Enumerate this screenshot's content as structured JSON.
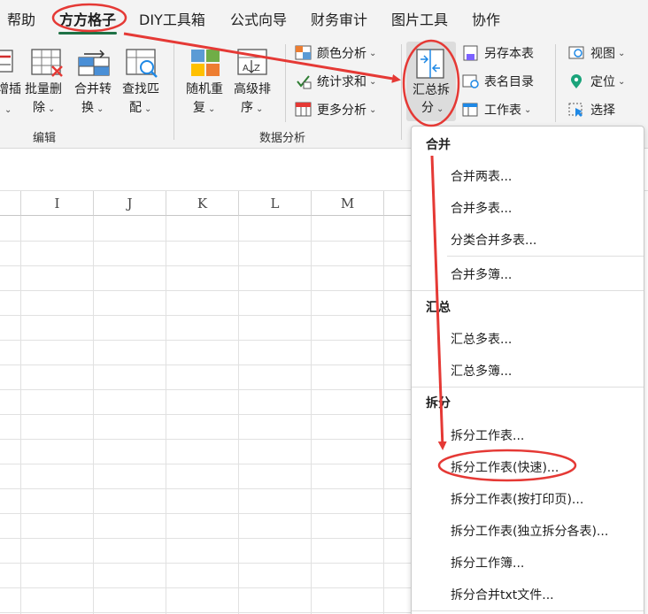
{
  "menubar": {
    "tabs": [
      {
        "label": "帮助",
        "active": false
      },
      {
        "label": "方方格子",
        "active": true
      },
      {
        "label": "DIY工具箱",
        "active": false
      },
      {
        "label": "公式向导",
        "active": false
      },
      {
        "label": "财务审计",
        "active": false
      },
      {
        "label": "图片工具",
        "active": false
      },
      {
        "label": "协作",
        "active": false
      }
    ]
  },
  "ribbon": {
    "edit_group": {
      "label": "编辑",
      "buttons": [
        {
          "line1": "增插",
          "line2": "",
          "icon": "insert-icon"
        },
        {
          "line1": "批量删",
          "line2": "除",
          "icon": "batch-delete-icon"
        },
        {
          "line1": "合并转",
          "line2": "换",
          "icon": "merge-convert-icon"
        },
        {
          "line1": "查找匹",
          "line2": "配",
          "icon": "lookup-match-icon"
        }
      ]
    },
    "analysis_group": {
      "label": "数据分析",
      "buttons": [
        {
          "line1": "随机重",
          "line2": "复",
          "icon": "random-repeat-icon"
        },
        {
          "line1": "高级排",
          "line2": "序",
          "icon": "advanced-sort-icon"
        }
      ],
      "small_buttons": [
        {
          "label": "颜色分析",
          "icon": "color-analysis-icon"
        },
        {
          "label": "统计求和",
          "icon": "stat-sum-icon"
        },
        {
          "label": "更多分析",
          "icon": "more-analysis-icon"
        }
      ]
    },
    "summary_button": {
      "line1": "汇总拆",
      "line2": "分",
      "icon": "summary-split-icon"
    },
    "sheet_small_buttons": [
      {
        "label": "另存本表",
        "icon": "save-sheet-icon"
      },
      {
        "label": "表名目录",
        "icon": "sheet-directory-icon"
      },
      {
        "label": "工作表",
        "icon": "worksheet-icon"
      }
    ],
    "view_small_buttons": [
      {
        "label": "视图",
        "icon": "view-icon"
      },
      {
        "label": "定位",
        "icon": "locate-pin-icon"
      },
      {
        "label": "选择",
        "icon": "select-icon"
      }
    ]
  },
  "sheet": {
    "columns": [
      "I",
      "J",
      "K",
      "L",
      "M"
    ]
  },
  "dropdown": {
    "sections": [
      {
        "title": "合并",
        "items": [
          "合并两表...",
          "合并多表...",
          "分类合并多表...",
          "合并多簿..."
        ]
      },
      {
        "title": "汇总",
        "items": [
          "汇总多表...",
          "汇总多簿..."
        ]
      },
      {
        "title": "拆分",
        "items": [
          "拆分工作表...",
          "拆分工作表(快速)...",
          "拆分工作表(按打印页)...",
          "拆分工作表(独立拆分各表)...",
          "拆分工作簿...",
          "拆分合并txt文件..."
        ]
      }
    ]
  },
  "annotation": {
    "color": "#e53935"
  },
  "colors": {
    "accent": "#1e7145",
    "annotation": "#e53935"
  }
}
